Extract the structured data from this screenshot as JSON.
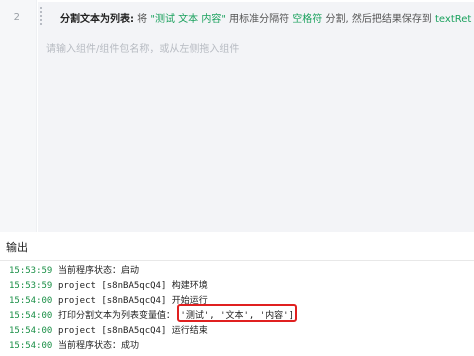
{
  "editor": {
    "line_number": "2",
    "step": {
      "title": "分割文本为列表:",
      "parts": [
        {
          "text": " 将 ",
          "kind": "plain"
        },
        {
          "text": "\"测试 文本 内容\"",
          "kind": "val"
        },
        {
          "text": " 用标准分隔符 ",
          "kind": "plain"
        },
        {
          "text": "空格符",
          "kind": "val"
        },
        {
          "text": " 分割, 然后把结果保存到 ",
          "kind": "plain"
        },
        {
          "text": "textRet",
          "kind": "val"
        }
      ]
    },
    "input_placeholder": "请输入组件/组件包名称，或从左侧拖入组件"
  },
  "output": {
    "title": "输出",
    "rows": [
      {
        "time": "15:53:59",
        "message": "当前程序状态：启动"
      },
      {
        "time": "15:53:59",
        "message": "project [s8nBA5qcQ4] 构建环境"
      },
      {
        "time": "15:54:00",
        "message": "project [s8nBA5qcQ4] 开始运行"
      },
      {
        "time": "15:54:00",
        "message": "打印分割文本为列表变量值：['测试', '文本', '内容']"
      },
      {
        "time": "15:54:00",
        "message": "project [s8nBA5qcQ4] 运行结束"
      },
      {
        "time": "15:54:00",
        "message": "当前程序状态：成功"
      }
    ]
  },
  "colors": {
    "time": "#1a8f46",
    "value_token": "#1aa15d",
    "highlight_border": "#e02020"
  }
}
